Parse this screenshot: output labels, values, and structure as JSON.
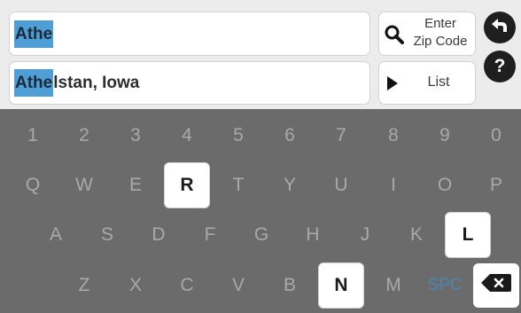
{
  "search": {
    "query": "Athe"
  },
  "result": {
    "match": "Athe",
    "rest": "lstan, Iowa"
  },
  "zip_button": {
    "label_line1": "Enter",
    "label_line2": "Zip Code",
    "icon": "magnifier-icon"
  },
  "list_button": {
    "label": "List",
    "icon": "play-triangle-icon"
  },
  "back_button": {
    "icon": "back-arrow-icon"
  },
  "help_button": {
    "label": "?"
  },
  "keyboard": {
    "row_digits": [
      "1",
      "2",
      "3",
      "4",
      "5",
      "6",
      "7",
      "8",
      "9",
      "0"
    ],
    "row_qwerty": [
      "Q",
      "W",
      "E",
      "R",
      "T",
      "Y",
      "U",
      "I",
      "O",
      "P"
    ],
    "row_asdf": [
      "A",
      "S",
      "D",
      "F",
      "G",
      "H",
      "J",
      "K",
      "L"
    ],
    "row_zxcv": [
      "Z",
      "X",
      "C",
      "V",
      "B",
      "N",
      "M"
    ],
    "space_label": "SPC",
    "delete_icon": "backspace-icon",
    "active_keys": [
      "R",
      "L",
      "N"
    ],
    "colors": {
      "background": "#6b6b6b",
      "disabled_key": "#a9a9a9",
      "space_key": "#4a86b4",
      "highlight": "#4f9fd6"
    }
  }
}
